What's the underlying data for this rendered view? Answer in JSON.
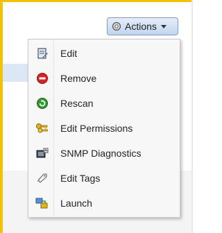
{
  "actions_button": {
    "label": "Actions",
    "icon": "gear-icon"
  },
  "menu": {
    "items": [
      {
        "label": "Edit",
        "icon": "edit-icon"
      },
      {
        "label": "Remove",
        "icon": "remove-icon"
      },
      {
        "label": "Rescan",
        "icon": "rescan-icon"
      },
      {
        "label": "Edit Permissions",
        "icon": "keys-icon"
      },
      {
        "label": "SNMP Diagnostics",
        "icon": "snmp-diagnostics-icon"
      },
      {
        "label": "Edit Tags",
        "icon": "tag-icon"
      },
      {
        "label": "Launch",
        "icon": "launch-icon"
      }
    ]
  },
  "colors": {
    "frame_accent": "#f2c200",
    "button_border": "#7f9bc2",
    "remove_red": "#d62424",
    "rescan_green": "#2f9a2f"
  }
}
